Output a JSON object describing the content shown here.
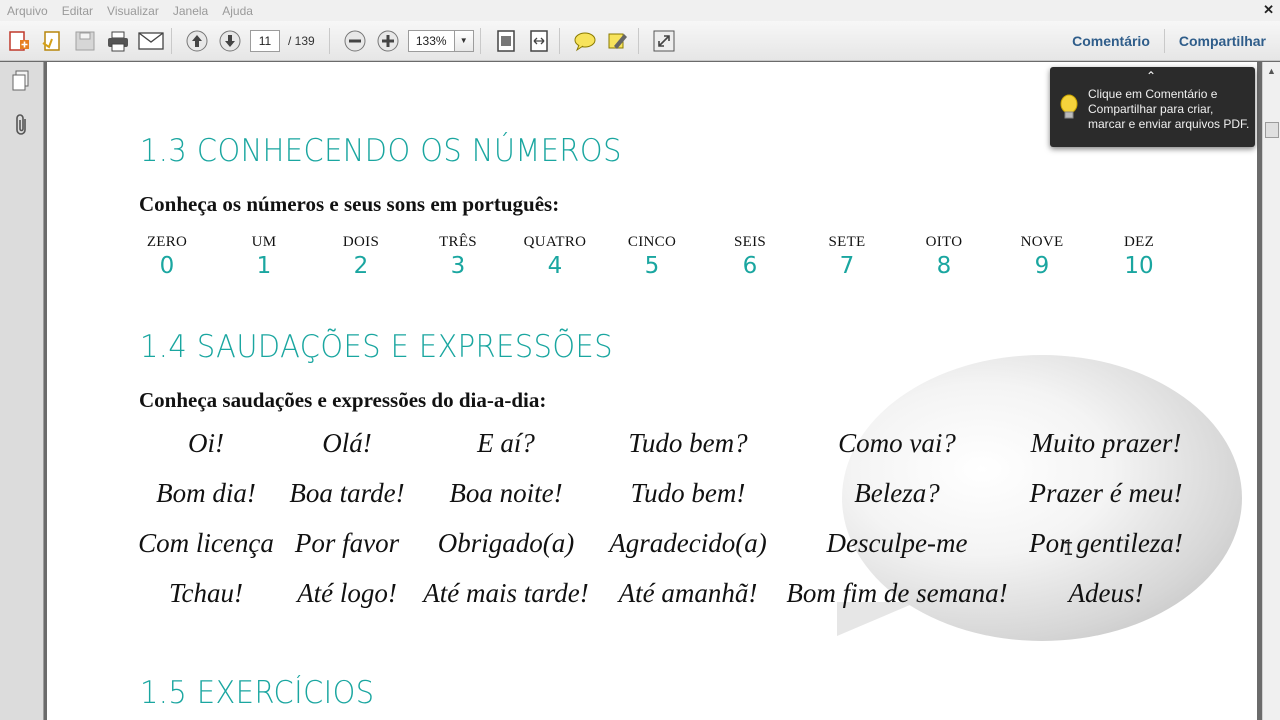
{
  "menu": [
    "Arquivo",
    "Editar",
    "Visualizar",
    "Janela",
    "Ajuda"
  ],
  "toolbar": {
    "current_page": "11",
    "page_total": "/ 139",
    "zoom": "133%",
    "comment_label": "Comentário",
    "share_label": "Compartilhar"
  },
  "tooltip": {
    "text": "Clique em Comentário e Compartilhar para criar, marcar e enviar arquivos PDF."
  },
  "doc": {
    "section1_title": "1.3 CONHECENDO OS NÚMEROS",
    "section1_intro": "Conheça os números e seus sons em português:",
    "numbers": [
      {
        "name": "ZERO",
        "digit": "0"
      },
      {
        "name": "UM",
        "digit": "1"
      },
      {
        "name": "DOIS",
        "digit": "2"
      },
      {
        "name": "TRÊS",
        "digit": "3"
      },
      {
        "name": "QUATRO",
        "digit": "4"
      },
      {
        "name": "CINCO",
        "digit": "5"
      },
      {
        "name": "SEIS",
        "digit": "6"
      },
      {
        "name": "SETE",
        "digit": "7"
      },
      {
        "name": "OITO",
        "digit": "8"
      },
      {
        "name": "NOVE",
        "digit": "9"
      },
      {
        "name": "DEZ",
        "digit": "10"
      }
    ],
    "section2_title": "1.4 SAUDAÇÕES E EXPRESSÕES",
    "section2_intro": "Conheça saudações e expressões do dia-a-dia:",
    "expressions": [
      [
        "Oi!",
        "Olá!",
        "E aí?",
        "Tudo bem?",
        "Como vai?",
        "Muito prazer!"
      ],
      [
        "Bom dia!",
        "Boa tarde!",
        "Boa noite!",
        "Tudo bem!",
        "Beleza?",
        "Prazer é meu!"
      ],
      [
        "Com licença",
        "Por favor",
        "Obrigado(a)",
        "Agradecido(a)",
        "Desculpe-me",
        "Por gentileza!"
      ],
      [
        "Tchau!",
        "Até logo!",
        "Até mais tarde!",
        "Até amanhã!",
        "Bom fim de semana!",
        "Adeus!"
      ]
    ],
    "section3_title": "1.5 EXERCÍCIOS"
  },
  "colors": {
    "accent": "#1aa6a0",
    "link": "#2f5d8a"
  }
}
